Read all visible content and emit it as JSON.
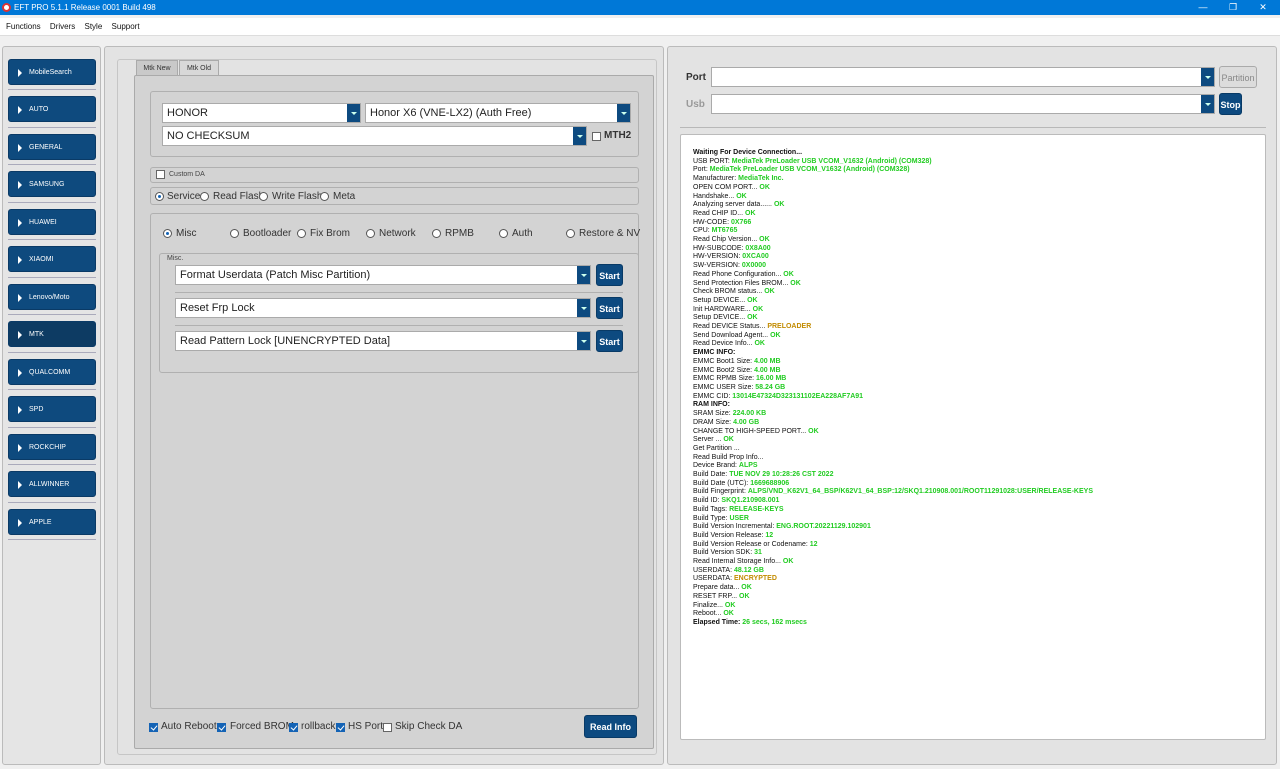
{
  "window": {
    "title": "EFT PRO 5.1.1 Release 0001 Build 498",
    "minimize": "—",
    "maximize": "❐",
    "close": "✕"
  },
  "menu": [
    "Functions",
    "Drivers",
    "Style",
    "Support"
  ],
  "sidebar": {
    "items": [
      "MobileSearch",
      "AUTO",
      "GENERAL",
      "SAMSUNG",
      "HUAWEI",
      "XIAOMI",
      "Lenovo/Moto",
      "MTK",
      "QUALCOMM",
      "SPD",
      "ROCKCHIP",
      "ALLWINNER",
      "APPLE"
    ],
    "active": "MTK"
  },
  "tabs": {
    "mtk_new": "Mtk New",
    "mtk_old": "Mtk Old"
  },
  "device": {
    "brand": "HONOR",
    "model": "Honor X6 (VNE-LX2) (Auth Free)",
    "checksum": "NO CHECKSUM",
    "mth2_label": "MTH2"
  },
  "custom_da_label": "Custom DA",
  "modes": [
    "Service",
    "Read Flash",
    "Write Flash",
    "Meta"
  ],
  "subtabs": [
    "Misc",
    "Bootloader",
    "Fix Brom",
    "Network",
    "RPMB",
    "Auth",
    "Restore & NV"
  ],
  "misc": {
    "group_label": "Misc.",
    "rows": [
      {
        "value": "Format Userdata (Patch Misc Partition)",
        "button": "Start"
      },
      {
        "value": "Reset Frp Lock",
        "button": "Start"
      },
      {
        "value": "Read Pattern Lock [UNENCRYPTED Data]",
        "button": "Start"
      }
    ]
  },
  "options": [
    {
      "label": "Auto Reboot",
      "checked": true
    },
    {
      "label": "Forced BROM",
      "checked": true
    },
    {
      "label": "rollback",
      "checked": true
    },
    {
      "label": "HS Port",
      "checked": true
    },
    {
      "label": "Skip Check DA",
      "checked": false
    }
  ],
  "read_info_button": "Read Info",
  "connection": {
    "port_label": "Port",
    "usb_label": "Usb",
    "partition_button": "Partition",
    "stop_button": "Stop"
  },
  "colors": {
    "accent": "#0d4a80",
    "ok": "#22cc22",
    "warn": "#c28b00",
    "titlebar": "#0078d7"
  },
  "log": [
    [
      "Waiting For Device Connection...",
      "",
      "hd"
    ],
    [
      "USB PORT: ",
      "MediaTek PreLoader USB VCOM_V1632 (Android) (COM328)",
      "ok"
    ],
    [
      "Port: ",
      "MediaTek PreLoader USB VCOM_V1632 (Android) (COM328)",
      "ok"
    ],
    [
      "Manufacturer: ",
      "MediaTek Inc.",
      "ok"
    ],
    [
      "OPEN COM PORT... ",
      "OK",
      "ok"
    ],
    [
      "Handshake... ",
      "OK",
      "ok"
    ],
    [
      "Analyzing server data...... ",
      "OK",
      "ok"
    ],
    [
      "Read CHIP ID... ",
      "OK",
      "ok"
    ],
    [
      "HW-CODE: ",
      "0X766",
      "ok"
    ],
    [
      "CPU: ",
      "MT6765",
      "ok"
    ],
    [
      "Read Chip Version... ",
      "OK",
      "ok"
    ],
    [
      "HW-SUBCODE: ",
      "0X8A00",
      "ok"
    ],
    [
      "HW-VERSION: ",
      "0XCA00",
      "ok"
    ],
    [
      "SW-VERSION: ",
      "0X0000",
      "ok"
    ],
    [
      "Read Phone Configuration... ",
      "OK",
      "ok"
    ],
    [
      "Send Protection Files BROM... ",
      "OK",
      "ok"
    ],
    [
      "Check BROM status... ",
      "OK",
      "ok"
    ],
    [
      "Setup DEVICE... ",
      "OK",
      "ok"
    ],
    [
      "Init HARDWARE... ",
      "OK",
      "ok"
    ],
    [
      "Setup DEVICE... ",
      "OK",
      "ok"
    ],
    [
      "Read DEVICE Status... ",
      "PRELOADER",
      "w"
    ],
    [
      "Send Download Agent... ",
      "OK",
      "ok"
    ],
    [
      "Read Device Info... ",
      "OK",
      "ok"
    ],
    [
      "EMMC INFO:",
      "",
      "hd"
    ],
    [
      "EMMC Boot1 Size: ",
      "4.00 MB",
      "ok"
    ],
    [
      "EMMC Boot2 Size: ",
      "4.00 MB",
      "ok"
    ],
    [
      "EMMC RPMB Size: ",
      "16.00 MB",
      "ok"
    ],
    [
      "EMMC USER Size: ",
      "58.24 GB",
      "ok"
    ],
    [
      "EMMC CID: ",
      "13014E47324D323131102EA228AF7A91",
      "ok"
    ],
    [
      " RAM INFO:",
      "",
      "hd"
    ],
    [
      "SRAM Size: ",
      "224.00 KB",
      "ok"
    ],
    [
      "DRAM Size: ",
      "4.00 GB",
      "ok"
    ],
    [
      "CHANGE TO HIGH-SPEED PORT... ",
      "OK",
      "ok"
    ],
    [
      "Server ... ",
      "OK",
      "ok"
    ],
    [
      "Get Partition ...",
      "",
      ""
    ],
    [
      "Read Build Prop Info...",
      "",
      ""
    ],
    [
      " Device Brand: ",
      "ALPS",
      "ok"
    ],
    [
      " Build Date: ",
      "TUE NOV 29 10:28:26 CST 2022",
      "ok"
    ],
    [
      " Build Date (UTC): ",
      "1669688906",
      "ok"
    ],
    [
      " Build Fingerprint: ",
      "ALPS/VND_K62V1_64_BSP/K62V1_64_BSP:12/SKQ1.210908.001/ROOT11291028:USER/RELEASE-KEYS",
      "ok"
    ],
    [
      " Build ID: ",
      "SKQ1.210908.001",
      "ok"
    ],
    [
      " Build Tags: ",
      "RELEASE-KEYS",
      "ok"
    ],
    [
      " Build Type: ",
      "USER",
      "ok"
    ],
    [
      " Build Version Incremental: ",
      "ENG.ROOT.20221129.102901",
      "ok"
    ],
    [
      " Build Version Release: ",
      "12",
      "ok"
    ],
    [
      " Build Version Release or Codename: ",
      "12",
      "ok"
    ],
    [
      " Build Version SDK: ",
      "31",
      "ok"
    ],
    [
      "Read Internal Storage Info... ",
      "OK",
      "ok"
    ],
    [
      "USERDATA: ",
      "48.12 GB",
      "ok"
    ],
    [
      "USERDATA: ",
      "ENCRYPTED",
      "w"
    ],
    [
      "Prepare data... ",
      "OK",
      "ok"
    ],
    [
      "RESET FRP... ",
      "OK",
      "ok"
    ],
    [
      "Finalize... ",
      "OK",
      "ok"
    ],
    [
      "Reboot... ",
      "OK",
      "ok"
    ],
    [
      "Elapsed Time: ",
      "26 secs, 162 msecs",
      "ok-hd"
    ]
  ]
}
